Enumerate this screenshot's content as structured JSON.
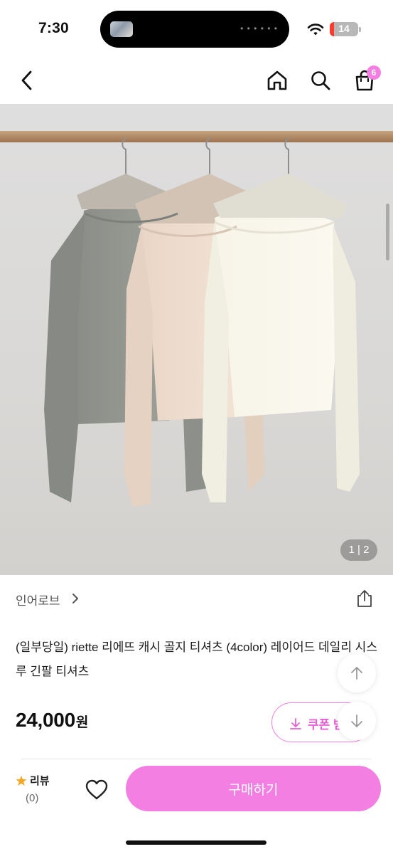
{
  "status_bar": {
    "time": "7:30",
    "battery_level": "14",
    "battery_fraction": 0.14,
    "battery_color": "#ff3b30"
  },
  "nav": {
    "cart_count": "6",
    "accent_color": "#f37fe2",
    "icons": [
      "chevron-left-icon",
      "home-icon",
      "search-icon",
      "shopping-bag-icon"
    ]
  },
  "gallery": {
    "counter": "1 | 2",
    "current": 1,
    "total": 2
  },
  "shop": {
    "name": "인어로브"
  },
  "product": {
    "title": "(일부당일) riette 리에뜨 캐시 골지 티셔츠 (4color) 레이어드 데일리 시스루 긴팔 티셔츠",
    "price": "24,000",
    "price_unit": "원"
  },
  "coupon": {
    "label": "쿠폰 받기"
  },
  "bottom_bar": {
    "review_label": "리뷰",
    "review_count": "(0)",
    "buy_label": "구매하기"
  }
}
